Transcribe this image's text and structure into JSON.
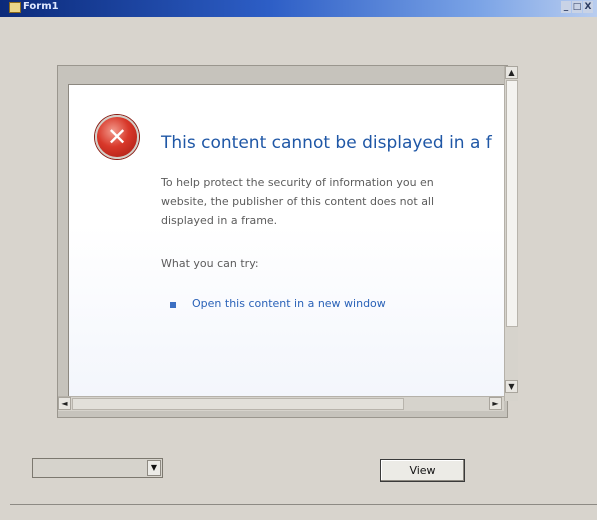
{
  "window": {
    "title": "Form1",
    "controls": [
      "_",
      "□",
      "X"
    ]
  },
  "icons": {
    "app": "form-app-icon",
    "error": "error-x-icon",
    "bullet": "blue-square-bullet-icon",
    "scroll_up": "▲",
    "scroll_down": "▼",
    "scroll_left": "◄",
    "scroll_right": "►",
    "dropdown": "▼"
  },
  "error_page": {
    "heading": "This content cannot be displayed in a f",
    "paragraph_lines": [
      "To help protect the security of information you en",
      "website, the publisher of this content does not all",
      "displayed in a frame."
    ],
    "what_you_can_try": "What you can try:",
    "link_text": "Open this content in a new window"
  },
  "controls": {
    "combo_value": "",
    "view_button_label": "View"
  },
  "colors": {
    "heading": "#1f57a6",
    "link": "#2a62b8",
    "error_red": "#d8382a",
    "window_bg": "#d8d4cd"
  }
}
